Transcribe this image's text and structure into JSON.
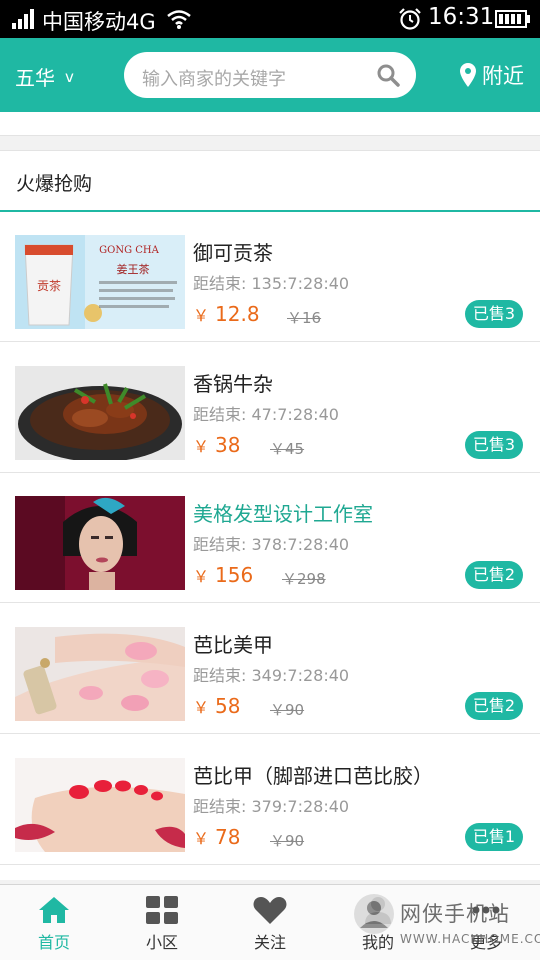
{
  "status_bar": {
    "carrier": "中国移动4G",
    "time": "16:31",
    "icons": [
      "signal-icon",
      "wifi-icon",
      "alarm-icon",
      "battery-icon"
    ]
  },
  "header": {
    "city": "五华",
    "city_chevron": "v",
    "search_placeholder": "输入商家的关键字",
    "nearby_label": "附近",
    "accent_color": "#1fb8a3"
  },
  "section": {
    "title": "火爆抢购"
  },
  "deals": [
    {
      "name": "御可贡茶",
      "countdown_label": "距结束:",
      "countdown": "135:7:28:40",
      "price_symbol": "￥",
      "price": "12.8",
      "original_price": "￥16",
      "sold": "已售3",
      "image_text_brand": "GONG CHA",
      "image_text_product": "姜王茶",
      "image_text_cup": "贡茶"
    },
    {
      "name": "香锅牛杂",
      "countdown_label": "距结束:",
      "countdown": "47:7:28:40",
      "price_symbol": "￥",
      "price": "38",
      "original_price": "￥45",
      "sold": "已售3"
    },
    {
      "name": "美格发型设计工作室",
      "countdown_label": "距结束:",
      "countdown": "378:7:28:40",
      "price_symbol": "￥",
      "price": "156",
      "original_price": "￥298",
      "sold": "已售2"
    },
    {
      "name": "芭比美甲",
      "countdown_label": "距结束:",
      "countdown": "349:7:28:40",
      "price_symbol": "￥",
      "price": "58",
      "original_price": "￥90",
      "sold": "已售2"
    },
    {
      "name": "芭比甲（脚部进口芭比胶）",
      "countdown_label": "距结束:",
      "countdown": "379:7:28:40",
      "price_symbol": "￥",
      "price": "78",
      "original_price": "￥90",
      "sold": "已售1"
    }
  ],
  "bottom_nav": [
    {
      "label": "首页",
      "icon": "home-icon",
      "active": true
    },
    {
      "label": "小区",
      "icon": "grid-icon",
      "active": false
    },
    {
      "label": "关注",
      "icon": "heart-icon",
      "active": false
    },
    {
      "label": "我的",
      "icon": "user-icon",
      "active": false
    },
    {
      "label": "更多",
      "icon": "more-icon",
      "active": false
    }
  ],
  "watermark": {
    "text": "网侠手机站",
    "url": "WWW.HACKHOME.COM"
  }
}
